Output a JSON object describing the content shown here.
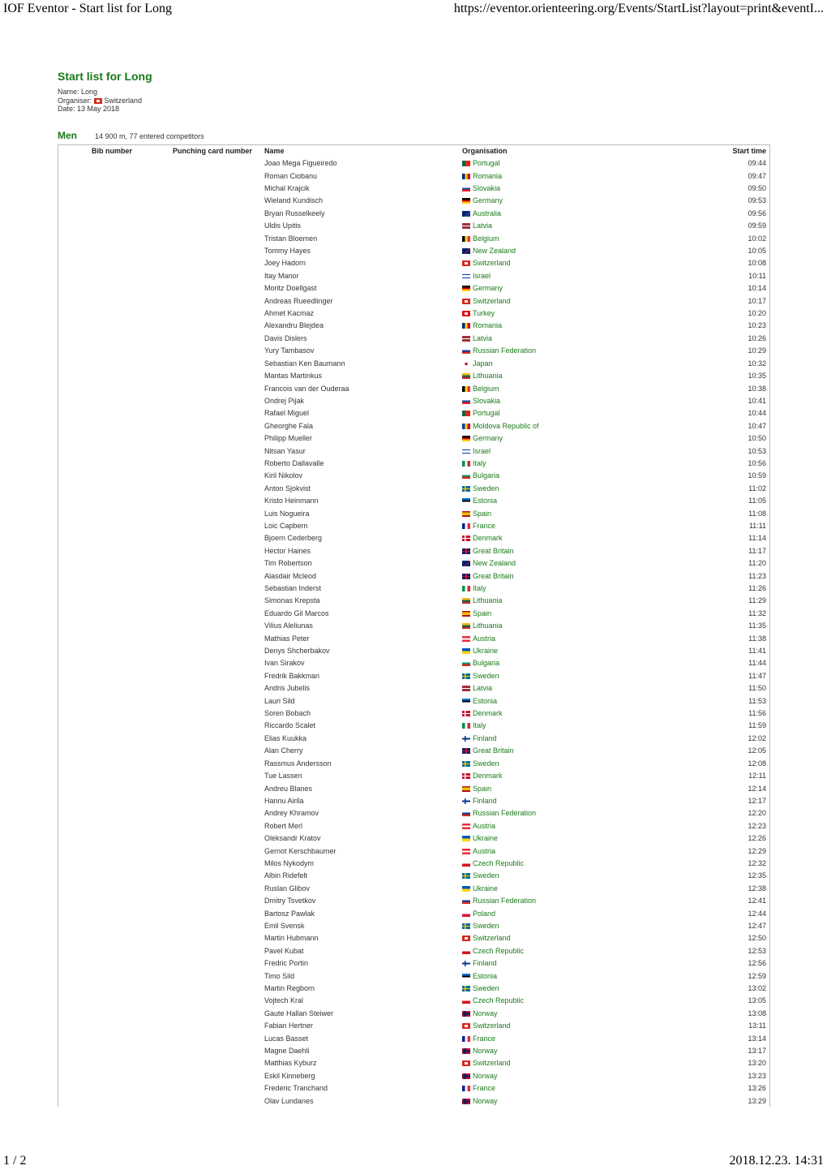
{
  "print_header": {
    "title": "IOF Eventor - Start list for Long",
    "url": "https://eventor.orienteering.org/Events/StartList?layout=print&eventI..."
  },
  "print_footer": {
    "page": "1 / 2",
    "datetime": "2018.12.23. 14:31"
  },
  "page": {
    "title": "Start list for Long",
    "name_line": "Name: Long",
    "organiser_label": "Organiser:",
    "organiser_country": "Switzerland",
    "date_line": "Date: 13 May 2018"
  },
  "class": {
    "name": "Men",
    "info": "14 900 m, 77 entered competitors"
  },
  "columns": {
    "bib": "Bib number",
    "card": "Punching card number",
    "name": "Name",
    "organisation": "Organisation",
    "start_time": "Start time"
  },
  "colors": {
    "accent_green": "#1a7a1a",
    "border": "#bbbbbb"
  },
  "rows": [
    {
      "name": "Joao Mega Figueiredo",
      "org": "Portugal",
      "time": "09:44"
    },
    {
      "name": "Roman Ciobanu",
      "org": "Romania",
      "time": "09:47"
    },
    {
      "name": "Michal Krajcik",
      "org": "Slovakia",
      "time": "09:50"
    },
    {
      "name": "Wieland Kundisch",
      "org": "Germany",
      "time": "09:53"
    },
    {
      "name": "Bryan Russelkeely",
      "org": "Australia",
      "time": "09:56"
    },
    {
      "name": "Uldis Upitis",
      "org": "Latvia",
      "time": "09:59"
    },
    {
      "name": "Tristan Bloemen",
      "org": "Belgium",
      "time": "10:02"
    },
    {
      "name": "Tommy Hayes",
      "org": "New Zealand",
      "time": "10:05"
    },
    {
      "name": "Joey Hadorn",
      "org": "Switzerland",
      "time": "10:08"
    },
    {
      "name": "Itay Manor",
      "org": "Israel",
      "time": "10:11"
    },
    {
      "name": "Moritz Doellgast",
      "org": "Germany",
      "time": "10:14"
    },
    {
      "name": "Andreas Rueedlinger",
      "org": "Switzerland",
      "time": "10:17"
    },
    {
      "name": "Ahmet Kacmaz",
      "org": "Turkey",
      "time": "10:20"
    },
    {
      "name": "Alexandru Blejdea",
      "org": "Romania",
      "time": "10:23"
    },
    {
      "name": "Davis Dislers",
      "org": "Latvia",
      "time": "10:26"
    },
    {
      "name": "Yury Tambasov",
      "org": "Russian Federation",
      "time": "10:29"
    },
    {
      "name": "Sebastian Ken Baumann",
      "org": "Japan",
      "time": "10:32"
    },
    {
      "name": "Mantas Martinkus",
      "org": "Lithuania",
      "time": "10:35"
    },
    {
      "name": "Francois van der Ouderaa",
      "org": "Belgium",
      "time": "10:38"
    },
    {
      "name": "Ondrej Pijak",
      "org": "Slovakia",
      "time": "10:41"
    },
    {
      "name": "Rafael Miguel",
      "org": "Portugal",
      "time": "10:44"
    },
    {
      "name": "Gheorghe Fala",
      "org": "Moldova Republic of",
      "time": "10:47"
    },
    {
      "name": "Philipp Mueller",
      "org": "Germany",
      "time": "10:50"
    },
    {
      "name": "Nitsan Yasur",
      "org": "Israel",
      "time": "10:53"
    },
    {
      "name": "Roberto Dallavalle",
      "org": "Italy",
      "time": "10:56"
    },
    {
      "name": "Kiril Nikolov",
      "org": "Bulgaria",
      "time": "10:59"
    },
    {
      "name": "Anton Sjokvist",
      "org": "Sweden",
      "time": "11:02"
    },
    {
      "name": "Kristo Heinmann",
      "org": "Estonia",
      "time": "11:05"
    },
    {
      "name": "Luis Nogueira",
      "org": "Spain",
      "time": "11:08"
    },
    {
      "name": "Loic Capbern",
      "org": "France",
      "time": "11:11"
    },
    {
      "name": "Bjoern Cederberg",
      "org": "Denmark",
      "time": "11:14"
    },
    {
      "name": "Hector Haines",
      "org": "Great Britain",
      "time": "11:17"
    },
    {
      "name": "Tim Robertson",
      "org": "New Zealand",
      "time": "11:20"
    },
    {
      "name": "Alasdair Mcleod",
      "org": "Great Britain",
      "time": "11:23"
    },
    {
      "name": "Sebastian Inderst",
      "org": "Italy",
      "time": "11:26"
    },
    {
      "name": "Simonas Krepsta",
      "org": "Lithuania",
      "time": "11:29"
    },
    {
      "name": "Eduardo Gil Marcos",
      "org": "Spain",
      "time": "11:32"
    },
    {
      "name": "Vilius Aleliunas",
      "org": "Lithuania",
      "time": "11:35"
    },
    {
      "name": "Mathias Peter",
      "org": "Austria",
      "time": "11:38"
    },
    {
      "name": "Denys Shcherbakov",
      "org": "Ukraine",
      "time": "11:41"
    },
    {
      "name": "Ivan Sirakov",
      "org": "Bulgaria",
      "time": "11:44"
    },
    {
      "name": "Fredrik Bakkman",
      "org": "Sweden",
      "time": "11:47"
    },
    {
      "name": "Andris Jubelis",
      "org": "Latvia",
      "time": "11:50"
    },
    {
      "name": "Lauri Sild",
      "org": "Estonia",
      "time": "11:53"
    },
    {
      "name": "Soren Bobach",
      "org": "Denmark",
      "time": "11:56"
    },
    {
      "name": "Riccardo Scalet",
      "org": "Italy",
      "time": "11:59"
    },
    {
      "name": "Elias Kuukka",
      "org": "Finland",
      "time": "12:02"
    },
    {
      "name": "Alan Cherry",
      "org": "Great Britain",
      "time": "12:05"
    },
    {
      "name": "Rassmus Andersson",
      "org": "Sweden",
      "time": "12:08"
    },
    {
      "name": "Tue Lassen",
      "org": "Denmark",
      "time": "12:11"
    },
    {
      "name": "Andreu Blanes",
      "org": "Spain",
      "time": "12:14"
    },
    {
      "name": "Hannu Airila",
      "org": "Finland",
      "time": "12:17"
    },
    {
      "name": "Andrey Khramov",
      "org": "Russian Federation",
      "time": "12:20"
    },
    {
      "name": "Robert Merl",
      "org": "Austria",
      "time": "12:23"
    },
    {
      "name": "Oleksandr Kratov",
      "org": "Ukraine",
      "time": "12:26"
    },
    {
      "name": "Gernot Kerschbaumer",
      "org": "Austria",
      "time": "12:29"
    },
    {
      "name": "Milos Nykodym",
      "org": "Czech Republic",
      "time": "12:32"
    },
    {
      "name": "Albin Ridefelt",
      "org": "Sweden",
      "time": "12:35"
    },
    {
      "name": "Ruslan Glibov",
      "org": "Ukraine",
      "time": "12:38"
    },
    {
      "name": "Dmitry Tsvetkov",
      "org": "Russian Federation",
      "time": "12:41"
    },
    {
      "name": "Bartosz Pawlak",
      "org": "Poland",
      "time": "12:44"
    },
    {
      "name": "Emil Svensk",
      "org": "Sweden",
      "time": "12:47"
    },
    {
      "name": "Martin Hubmann",
      "org": "Switzerland",
      "time": "12:50"
    },
    {
      "name": "Pavel Kubat",
      "org": "Czech Republic",
      "time": "12:53"
    },
    {
      "name": "Fredric Portin",
      "org": "Finland",
      "time": "12:56"
    },
    {
      "name": "Timo Sild",
      "org": "Estonia",
      "time": "12:59"
    },
    {
      "name": "Martin Regborn",
      "org": "Sweden",
      "time": "13:02"
    },
    {
      "name": "Vojtech Kral",
      "org": "Czech Republic",
      "time": "13:05"
    },
    {
      "name": "Gaute Hallan Steiwer",
      "org": "Norway",
      "time": "13:08"
    },
    {
      "name": "Fabian Hertner",
      "org": "Switzerland",
      "time": "13:11"
    },
    {
      "name": "Lucas Basset",
      "org": "France",
      "time": "13:14"
    },
    {
      "name": "Magne Daehli",
      "org": "Norway",
      "time": "13:17"
    },
    {
      "name": "Matthias Kyburz",
      "org": "Switzerland",
      "time": "13:20"
    },
    {
      "name": "Eskil Kinneberg",
      "org": "Norway",
      "time": "13:23"
    },
    {
      "name": "Frederic Tranchand",
      "org": "France",
      "time": "13:26"
    },
    {
      "name": "Olav Lundanes",
      "org": "Norway",
      "time": "13:29"
    }
  ]
}
